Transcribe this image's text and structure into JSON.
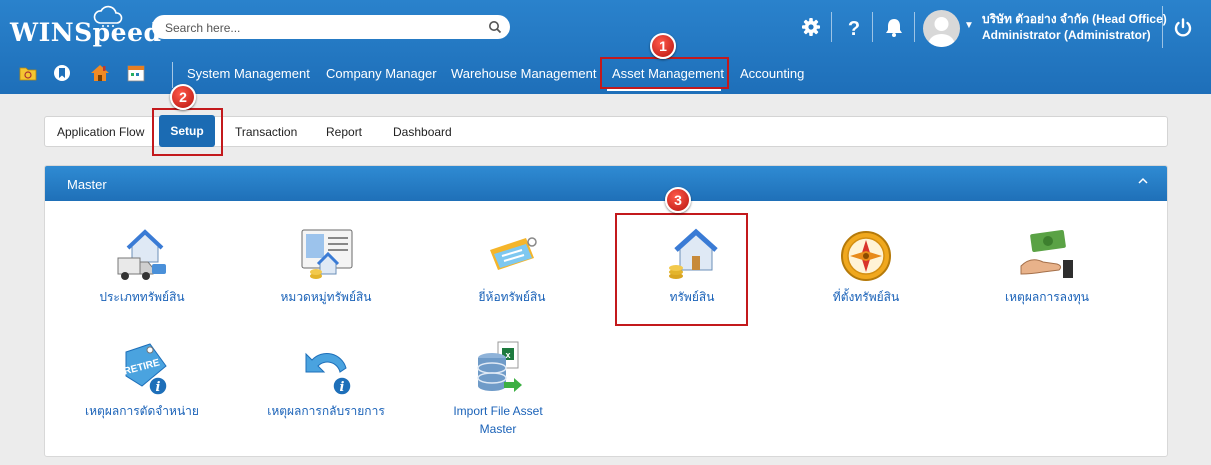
{
  "header": {
    "logo": "WINSpeed",
    "search_placeholder": "Search here...",
    "user_company": "บริษัท ตัวอย่าง จำกัด (Head Office)",
    "user_role": "Administrator (Administrator)"
  },
  "quick_icons": [
    "folder-icon",
    "bookmark-icon",
    "home-icon",
    "calendar-icon"
  ],
  "menu": [
    "System Management",
    "Company Manager",
    "Warehouse Management",
    "Asset Management",
    "Accounting"
  ],
  "tabs": [
    "Application Flow",
    "Setup",
    "Transaction",
    "Report",
    "Dashboard"
  ],
  "panel": {
    "title": "Master"
  },
  "items": [
    {
      "label": "ประเภททรัพย์สิน",
      "icon": "asset-type-icon"
    },
    {
      "label": "หมวดหมู่ทรัพย์สิน",
      "icon": "asset-category-icon"
    },
    {
      "label": "ยี่ห้อทรัพย์สิน",
      "icon": "asset-brand-icon"
    },
    {
      "label": "ทรัพย์สิน",
      "icon": "asset-icon"
    },
    {
      "label": "ที่ตั้งทรัพย์สิน",
      "icon": "asset-location-icon"
    },
    {
      "label": "เหตุผลการลงทุน",
      "icon": "investment-reason-icon"
    },
    {
      "label": "เหตุผลการตัดจำหน่าย",
      "icon": "retire-reason-icon"
    },
    {
      "label": "เหตุผลการกลับรายการ",
      "icon": "reversal-reason-icon"
    },
    {
      "label": "Import File Asset Master",
      "icon": "import-file-icon"
    }
  ],
  "badges": [
    "1",
    "2",
    "3"
  ],
  "colors": {
    "header": "#1e6fb9",
    "accent": "#1b6bb3",
    "link": "#1a62b8",
    "highlight": "#c3191c"
  }
}
